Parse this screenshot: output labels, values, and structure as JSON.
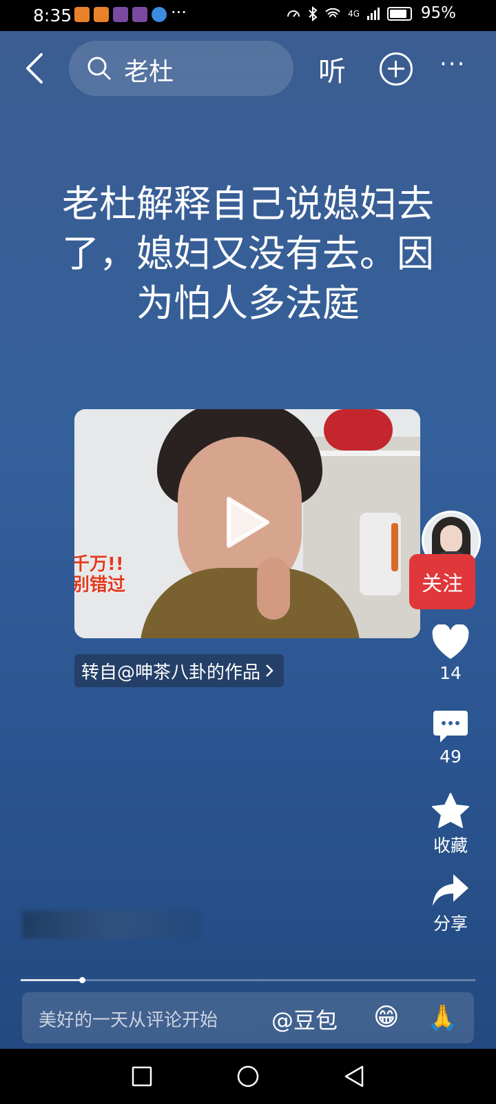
{
  "status_bar": {
    "time": "8:35",
    "more": "···",
    "network": "4G",
    "battery": "95%"
  },
  "top_bar": {
    "search_query": "老杜",
    "listen_label": "听"
  },
  "post": {
    "headline": "老杜解释自己说媳妇去了，媳妇又没有去。因为怕人多法庭",
    "video_sticker": "千万!!\n别错过",
    "source": "转自@呻茶八卦的作品"
  },
  "side": {
    "follow_label": "关注",
    "likes": "14",
    "comments": "49",
    "favorite_label": "收藏",
    "share_label": "分享"
  },
  "progress": {
    "fraction": 0.135
  },
  "comment_bar": {
    "placeholder": "美好的一天从评论开始",
    "mention": "@豆包",
    "emoji_1": "😁",
    "emoji_2": "🙏"
  },
  "colors": {
    "follow": "#e0373a",
    "bg_top": "#3b5d91",
    "bg_bottom": "#234a80"
  }
}
